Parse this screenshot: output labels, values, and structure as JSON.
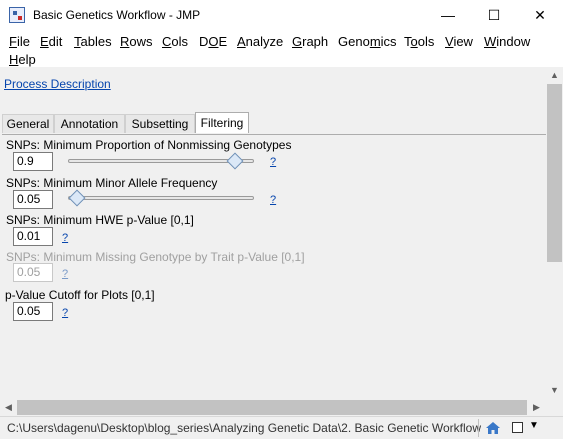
{
  "window": {
    "title": "Basic Genetics Workflow - JMP",
    "icon": "jmp-app-icon",
    "controls": {
      "minimize": "—",
      "maximize": "☐",
      "close": "✕"
    }
  },
  "menu": [
    {
      "pre": "",
      "key": "F",
      "post": "ile"
    },
    {
      "pre": "",
      "key": "E",
      "post": "dit"
    },
    {
      "pre": "",
      "key": "T",
      "post": "ables"
    },
    {
      "pre": "",
      "key": "R",
      "post": "ows"
    },
    {
      "pre": "",
      "key": "C",
      "post": "ols"
    },
    {
      "pre": "D",
      "key": "O",
      "post": "E"
    },
    {
      "pre": "",
      "key": "A",
      "post": "nalyze"
    },
    {
      "pre": "",
      "key": "G",
      "post": "raph"
    },
    {
      "pre": "Geno",
      "key": "m",
      "post": "ics"
    },
    {
      "pre": "T",
      "key": "o",
      "post": "ols"
    },
    {
      "pre": "",
      "key": "V",
      "post": "iew"
    },
    {
      "pre": "",
      "key": "W",
      "post": "indow"
    },
    {
      "pre": "",
      "key": "H",
      "post": "elp"
    }
  ],
  "process_description_link": "Process Description",
  "tabs": [
    {
      "label": "General",
      "active": false
    },
    {
      "label": "Annotation",
      "active": false
    },
    {
      "label": "Subsetting",
      "active": false
    },
    {
      "label": "Filtering",
      "active": true
    }
  ],
  "filters": [
    {
      "label": "SNPs: Minimum Proportion of Nonmissing Genotypes",
      "value": "0.9",
      "slider_level": 0.9,
      "help": "?",
      "enabled": true
    },
    {
      "label": "SNPs: Minimum Minor Allele Frequency",
      "value": "0.05",
      "slider_level": 0.05,
      "help": "?",
      "enabled": true
    },
    {
      "label": "SNPs: Minimum HWE p-Value [0,1]",
      "value": "0.01",
      "help": "?",
      "enabled": true
    },
    {
      "label": "SNPs: Minimum Missing Genotype by Trait p-Value [0,1]",
      "value": "0.05",
      "help": "?",
      "enabled": false
    },
    {
      "label": "p-Value Cutoff for Plots [0,1]",
      "value": "0.05",
      "help": "?",
      "enabled": true
    }
  ],
  "status_bar": {
    "path": "C:\\Users\\dagenu\\Desktop\\blog_series\\Analyzing Genetic Data\\2. Basic Genetic Workflow",
    "icons": [
      "home-icon",
      "square-icon",
      "dropdown-arrow-icon"
    ]
  }
}
